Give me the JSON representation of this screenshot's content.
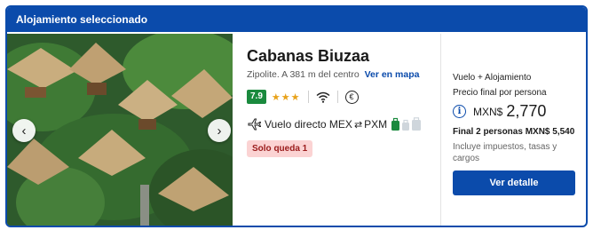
{
  "header": {
    "title": "Alojamiento seleccionado"
  },
  "gallery": {
    "prev_icon": "chevron-left-icon",
    "next_icon": "chevron-right-icon"
  },
  "hotel": {
    "name": "Cabanas Biuzaa",
    "location": "Zipolite. A 381 m del centro",
    "map_link": "Ver en mapa",
    "rating": "7.9",
    "stars": 3,
    "stars_display": "★★★",
    "amenity_icons": [
      "wifi-icon",
      "euro-icon"
    ],
    "euro_symbol": "€"
  },
  "flight": {
    "label": "Vuelo directo MEX",
    "swap": "⇄",
    "destination": "PXM"
  },
  "availability": {
    "label": "Solo queda 1"
  },
  "pricing": {
    "package_type": "Vuelo + Alojamiento",
    "per_person_label": "Precio final por persona",
    "currency": "MXN$",
    "amount": "2,770",
    "total_label": "Final 2 personas MXN$ 5,540",
    "taxes_note": "Incluye impuestos, tasas y cargos",
    "cta_label": "Ver detalle"
  },
  "colors": {
    "brand": "#0b4bab",
    "rating": "#1a8a3e",
    "stars": "#e8a21a",
    "badge_bg": "#fbd3d3"
  }
}
